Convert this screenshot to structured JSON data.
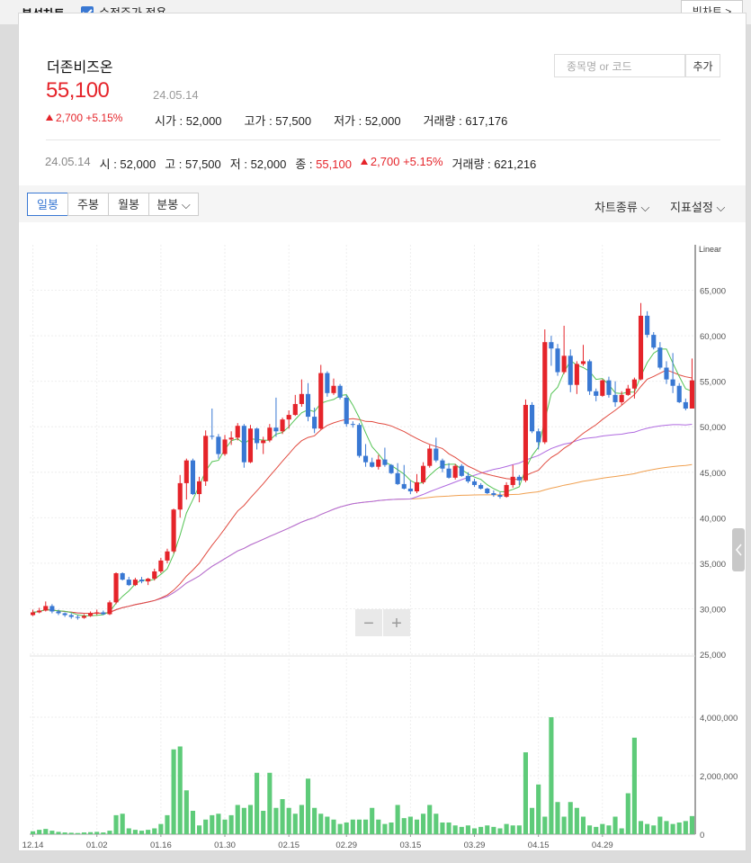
{
  "header": {
    "title": "분석차트",
    "adjusted_label": "수정주가 적용",
    "adjusted_checked": true,
    "big_chart_label": "빅차트 >"
  },
  "stock": {
    "name": "더존비즈온",
    "price": "55,100",
    "date": "24.05.14",
    "change": "2,700",
    "change_pct": "+5.15%",
    "open_label": "시가",
    "open": "52,000",
    "high_label": "고가",
    "high": "57,500",
    "low_label": "저가",
    "low": "52,000",
    "volume_label": "거래량",
    "volume": "617,176"
  },
  "search": {
    "placeholder": "종목명 or 코드",
    "add_label": "추가"
  },
  "daily": {
    "date": "24.05.14",
    "open_label": "시",
    "open": "52,000",
    "high_label": "고",
    "high": "57,500",
    "low_label": "저",
    "low": "52,000",
    "close_label": "종",
    "close": "55,100",
    "change": "2,700",
    "change_pct": "+5.15%",
    "volume_label": "거래량",
    "volume": "621,216"
  },
  "toolbar": {
    "tabs": [
      "일봉",
      "주봉",
      "월봉",
      "분봉"
    ],
    "selected": 0,
    "chart_type_label": "차트종류",
    "indicator_label": "지표설정"
  },
  "colors": {
    "up": "#e5242a",
    "down": "#3978d3",
    "volume": "#5ecb79",
    "ma5": "#55c455",
    "ma20": "#e14b40",
    "ma60": "#b06be0",
    "ma120": "#f0a050"
  },
  "chart_data": {
    "type": "candlestick",
    "scale_label": "Linear",
    "price_ticks": [
      "65,000",
      "60,000",
      "55,000",
      "50,000",
      "45,000",
      "40,000",
      "35,000",
      "30,000",
      "25,000"
    ],
    "price_tick_values": [
      65000,
      60000,
      55000,
      50000,
      45000,
      40000,
      35000,
      30000,
      25000
    ],
    "ylim": [
      25000,
      70000
    ],
    "volume_ticks": [
      "4,000,000",
      "2,000,000",
      "0"
    ],
    "volume_tick_values": [
      4000000,
      2000000,
      0
    ],
    "volume_ylim": [
      0,
      6000000
    ],
    "x_labels": [
      "12.14",
      "01.02",
      "01.16",
      "01.30",
      "02.15",
      "02.29",
      "03.15",
      "03.29",
      "04.15",
      "04.29"
    ],
    "x_label_index": [
      0,
      10,
      20,
      30,
      40,
      49,
      59,
      69,
      79,
      89
    ],
    "zoom_out_label": "−",
    "zoom_in_label": "+",
    "candles": [
      [
        29300,
        29900,
        29200,
        29600,
        100000
      ],
      [
        29600,
        30100,
        29500,
        29800,
        150000
      ],
      [
        29800,
        30800,
        29700,
        30300,
        180000
      ],
      [
        30300,
        30500,
        29500,
        29700,
        120000
      ],
      [
        29700,
        29900,
        29300,
        29500,
        80000
      ],
      [
        29500,
        29600,
        29100,
        29300,
        60000
      ],
      [
        29300,
        29500,
        28900,
        29100,
        50000
      ],
      [
        29100,
        29300,
        28800,
        29000,
        40000
      ],
      [
        29000,
        29400,
        28900,
        29200,
        60000
      ],
      [
        29200,
        29700,
        29100,
        29500,
        70000
      ],
      [
        29500,
        29900,
        29300,
        29600,
        80000
      ],
      [
        29600,
        29800,
        29300,
        29400,
        60000
      ],
      [
        29400,
        30900,
        29300,
        30700,
        120000
      ],
      [
        30700,
        34000,
        30500,
        33900,
        650000
      ],
      [
        33900,
        34000,
        33100,
        33200,
        700000
      ],
      [
        33200,
        33500,
        32500,
        32600,
        200000
      ],
      [
        32600,
        33400,
        32500,
        33200,
        150000
      ],
      [
        33200,
        33500,
        32800,
        33000,
        120000
      ],
      [
        33000,
        33400,
        32600,
        33300,
        150000
      ],
      [
        33300,
        34400,
        33100,
        34100,
        200000
      ],
      [
        34100,
        35600,
        33900,
        35300,
        350000
      ],
      [
        35300,
        36600,
        35000,
        36300,
        650000
      ],
      [
        36300,
        41000,
        36100,
        40900,
        2900000
      ],
      [
        40900,
        44700,
        40000,
        43800,
        3000000
      ],
      [
        43800,
        46500,
        42000,
        46300,
        1500000
      ],
      [
        46300,
        46500,
        42500,
        42600,
        800000
      ],
      [
        42600,
        44500,
        41700,
        44000,
        300000
      ],
      [
        44000,
        49600,
        43500,
        49000,
        500000
      ],
      [
        49000,
        52000,
        48600,
        48900,
        650000
      ],
      [
        48900,
        49200,
        46500,
        47000,
        700000
      ],
      [
        47000,
        49100,
        46800,
        48600,
        500000
      ],
      [
        48600,
        49500,
        48000,
        48800,
        650000
      ],
      [
        48800,
        50400,
        48500,
        50100,
        1000000
      ],
      [
        50100,
        50300,
        45500,
        46100,
        900000
      ],
      [
        46100,
        50200,
        46000,
        49800,
        1000000
      ],
      [
        49800,
        49900,
        47500,
        48200,
        2100000
      ],
      [
        48200,
        48900,
        47000,
        48500,
        800000
      ],
      [
        48500,
        50300,
        48300,
        49900,
        2100000
      ],
      [
        49900,
        53200,
        48900,
        49500,
        900000
      ],
      [
        49500,
        51000,
        49200,
        50800,
        1200000
      ],
      [
        50800,
        51800,
        49800,
        51300,
        900000
      ],
      [
        51300,
        53500,
        51200,
        52500,
        700000
      ],
      [
        52500,
        55200,
        52200,
        53600,
        1000000
      ],
      [
        53600,
        54800,
        50600,
        51100,
        1900000
      ],
      [
        51100,
        52100,
        49300,
        49800,
        900000
      ],
      [
        49800,
        56800,
        49700,
        55900,
        700000
      ],
      [
        55900,
        56100,
        53300,
        53700,
        600000
      ],
      [
        53700,
        55300,
        53500,
        54500,
        500000
      ],
      [
        54500,
        54700,
        53000,
        53200,
        350000
      ],
      [
        53200,
        53500,
        50000,
        50300,
        400000
      ],
      [
        50300,
        50600,
        49900,
        50200,
        500000
      ],
      [
        50200,
        50400,
        46600,
        46800,
        500000
      ],
      [
        46800,
        48100,
        45600,
        46100,
        500000
      ],
      [
        46100,
        46600,
        45500,
        45600,
        900000
      ],
      [
        45600,
        46900,
        45300,
        46400,
        500000
      ],
      [
        46400,
        47700,
        45600,
        45800,
        350000
      ],
      [
        45800,
        45900,
        44800,
        44900,
        400000
      ],
      [
        44900,
        46000,
        43600,
        43700,
        1000000
      ],
      [
        43700,
        45800,
        43100,
        43200,
        550000
      ],
      [
        43200,
        44100,
        42600,
        42900,
        600000
      ],
      [
        42900,
        44800,
        42700,
        43900,
        500000
      ],
      [
        43900,
        46100,
        43700,
        45700,
        700000
      ],
      [
        45700,
        48000,
        45500,
        47600,
        1000000
      ],
      [
        47600,
        48800,
        46100,
        46300,
        700000
      ],
      [
        46300,
        46500,
        45000,
        45400,
        400000
      ],
      [
        45400,
        46000,
        44300,
        44400,
        400000
      ],
      [
        44400,
        45900,
        44200,
        45700,
        300000
      ],
      [
        45700,
        45900,
        44500,
        44600,
        250000
      ],
      [
        44600,
        45000,
        43800,
        44000,
        300000
      ],
      [
        44000,
        44300,
        43400,
        43600,
        200000
      ],
      [
        43600,
        43800,
        43100,
        43200,
        250000
      ],
      [
        43200,
        43300,
        42600,
        42700,
        300000
      ],
      [
        42700,
        43000,
        42300,
        42500,
        250000
      ],
      [
        42500,
        42800,
        42100,
        42300,
        200000
      ],
      [
        42300,
        43900,
        42200,
        43600,
        350000
      ],
      [
        43600,
        45800,
        43300,
        44500,
        300000
      ],
      [
        44500,
        44700,
        43600,
        44100,
        300000
      ],
      [
        44100,
        53000,
        43900,
        52400,
        2800000
      ],
      [
        52400,
        52700,
        49300,
        49500,
        900000
      ],
      [
        49500,
        49800,
        47500,
        48300,
        1700000
      ],
      [
        48300,
        60700,
        48100,
        59300,
        600000
      ],
      [
        59300,
        60000,
        56700,
        58600,
        4000000
      ],
      [
        58600,
        59100,
        55600,
        56000,
        1100000
      ],
      [
        56000,
        61100,
        55800,
        57800,
        600000
      ],
      [
        57800,
        58500,
        53800,
        54600,
        1100000
      ],
      [
        54600,
        57200,
        53600,
        56900,
        900000
      ],
      [
        56900,
        59000,
        56700,
        57200,
        600000
      ],
      [
        57200,
        57400,
        53500,
        53900,
        300000
      ],
      [
        53900,
        54200,
        52800,
        53400,
        250000
      ],
      [
        53400,
        55200,
        53300,
        55100,
        350000
      ],
      [
        55100,
        55500,
        53200,
        53500,
        300000
      ],
      [
        53500,
        55000,
        52200,
        52700,
        600000
      ],
      [
        52700,
        53900,
        52400,
        53500,
        200000
      ],
      [
        53500,
        54600,
        53400,
        54200,
        1400000
      ],
      [
        54200,
        55400,
        53100,
        55200,
        3300000
      ],
      [
        55200,
        63600,
        55100,
        62200,
        450000
      ],
      [
        62200,
        62700,
        59800,
        60100,
        350000
      ],
      [
        60100,
        60400,
        58500,
        58700,
        300000
      ],
      [
        58700,
        59300,
        56300,
        56500,
        600000
      ],
      [
        56500,
        57200,
        54700,
        55200,
        450000
      ],
      [
        55200,
        58100,
        53700,
        54500,
        350000
      ],
      [
        54500,
        54800,
        52600,
        52700,
        400000
      ],
      [
        52700,
        53100,
        51800,
        52000,
        450000
      ],
      [
        52000,
        57500,
        52000,
        55100,
        620000
      ]
    ]
  }
}
